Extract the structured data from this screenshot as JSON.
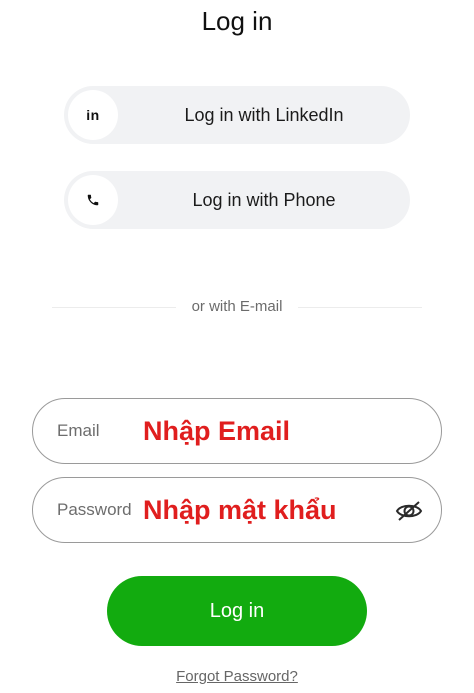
{
  "header": {
    "title": "Log in"
  },
  "social": {
    "linkedin": {
      "icon": "linkedin-icon",
      "glyph": "in",
      "label": "Log in with LinkedIn"
    },
    "phone": {
      "icon": "phone-icon",
      "label": "Log in with Phone"
    }
  },
  "divider": {
    "text": "or with E-mail"
  },
  "form": {
    "email": {
      "placeholder": "Email",
      "value": "",
      "annotation": "Nhập Email"
    },
    "password": {
      "placeholder": "Password",
      "value": "",
      "annotation": "Nhập mật khẩu",
      "toggle_icon": "eye-off-icon"
    }
  },
  "actions": {
    "login_label": "Log in",
    "forgot_label": "Forgot Password?"
  },
  "colors": {
    "primary": "#12ab0f",
    "social_bg": "#f1f2f4",
    "annotation": "#e01e1e",
    "field_border": "#9a9a9a"
  }
}
